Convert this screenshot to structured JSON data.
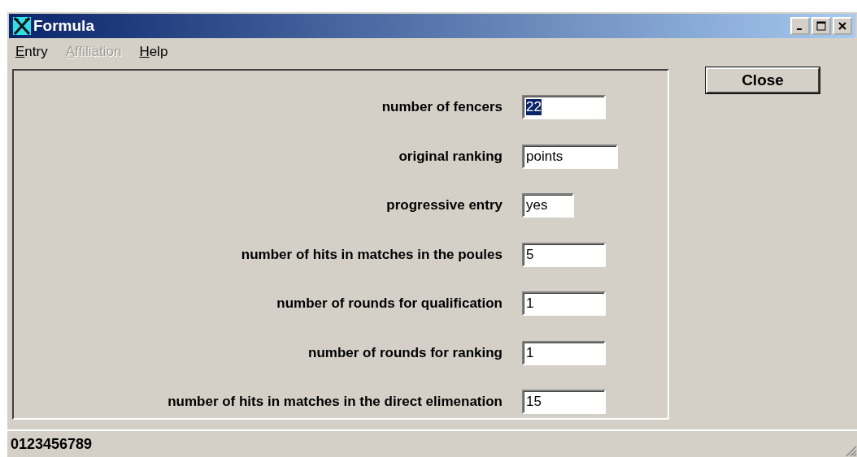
{
  "window": {
    "title": "Formula"
  },
  "menu": [
    {
      "label": "Entry",
      "first_letter_underlined": true,
      "disabled": false
    },
    {
      "label": "Affiliation",
      "first_letter_underlined": true,
      "disabled": true
    },
    {
      "label": "Help",
      "first_letter_underlined": true,
      "disabled": false
    }
  ],
  "fields": [
    {
      "label": "number of fencers",
      "value": "22",
      "selected": true
    },
    {
      "label": "original ranking",
      "value": "points",
      "selected": false
    },
    {
      "label": "progressive entry",
      "value": "yes",
      "selected": false
    },
    {
      "label": "number of hits in matches in the poules",
      "value": "5",
      "selected": false
    },
    {
      "label": "number of rounds for qualification",
      "value": "1",
      "selected": false
    },
    {
      "label": "number of rounds for ranking",
      "value": "1",
      "selected": false
    },
    {
      "label": "number of hits in matches in the direct elimenation",
      "value": "15",
      "selected": false
    }
  ],
  "close_button": "Close",
  "status_bar": "0123456789"
}
